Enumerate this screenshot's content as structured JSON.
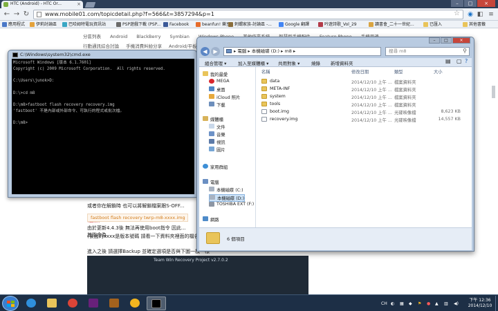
{
  "browser": {
    "tab_title": "HTC (Android) - HTC Or...",
    "url": "www.mobile01.com/topicdetail.php?f=566&t=3857294&p=1",
    "bookmarks": [
      "應用程式",
      "伊莉討論區",
      "巴哈姆特電玩資訊站",
      "PSP遊戲下載 (PSP...",
      "Facebook",
      "beanfun! 樂豆",
      "刺蝟家族-討論區 -...",
      "Google 翻譯",
      "吟遊詩歌_Vol_29",
      "讀書會_二十一世紀...",
      "已匯入",
      "其他書籤"
    ]
  },
  "webpage": {
    "nav1": [
      "分區列表",
      "Android",
      "BlackBerry",
      "Symbian",
      "Windows Phone",
      "其他作業系統",
      "智慧型手機配件",
      "Feature Phone",
      "手機周邊"
    ],
    "nav2": [
      "行動通訊綜合討論",
      "手機消費糾紛分享",
      "Android/平板..."
    ],
    "p_boot": "或者你在解鎖時 也可以將解鎖檔案跟S-OFF...",
    "update_label": "(更新)",
    "p_update1": "由於更新4.4.3後 無法再使用boot指令 因此...",
    "p_update2": "其指令為",
    "code": "fastboot flash recovery twrp-m8-xxxx.img",
    "p_xxxx": "(後面的xxxx是版本號碼 請看一下資料夾裡面的檔名下去打)",
    "p_backup": "進入之後 請選擇Backup 並確定選項是否與下圖一模一樣",
    "twrp_banner": "Team Win Recovery Project  v2.7.0.2"
  },
  "cmd": {
    "title": "C:\\Windows\\system32\\cmd.exe",
    "lines": [
      "Microsoft Windows [版本 6.1.7601]",
      "Copyright (c) 2009 Microsoft Corporation.  All rights reserved.",
      "",
      "C:\\Users\\junok>D:",
      "",
      "D:\\>cd m8",
      "",
      "D:\\m8>fastboot flash recovery recovery.img",
      "'fastboot' 不是內部或外部命令、可執行的程式或批次檔。",
      "",
      "D:\\m8>"
    ]
  },
  "explorer": {
    "breadcrumb": "▸ 電腦 ▸ 本機磁碟 (D:) ▸ m8 ▸",
    "search_placeholder": "搜尋 m8",
    "toolbar": [
      "組合管理 ▾",
      "加入至媒體櫃 ▾",
      "共用對象 ▾",
      "燒錄",
      "新增資料夾"
    ],
    "nav": {
      "favorites": "我的最愛",
      "mega": "MEGA",
      "desktop": "桌面",
      "icloud": "iCloud 照片",
      "downloads": "下載",
      "libraries": "媒體櫃",
      "documents": "文件",
      "music": "音樂",
      "videos": "視訊",
      "pictures": "圖片",
      "homegroup": "家用群組",
      "computer": "電腦",
      "drive_c": "本機磁碟 (C:)",
      "drive_d": "本機磁碟 (D:)",
      "drive_f": "TOSHIBA EXT (F:)",
      "network": "網路"
    },
    "columns": {
      "name": "名稱",
      "date": "修改日期",
      "type": "類型",
      "size": "大小"
    },
    "files": [
      {
        "name": "data",
        "date": "2014/12/10 上午 ...",
        "type": "檔案資料夾",
        "size": "",
        "kind": "folder"
      },
      {
        "name": "META-INF",
        "date": "2014/12/10 上午 ...",
        "type": "檔案資料夾",
        "size": "",
        "kind": "folder"
      },
      {
        "name": "system",
        "date": "2014/12/10 上午 ...",
        "type": "檔案資料夾",
        "size": "",
        "kind": "folder"
      },
      {
        "name": "tools",
        "date": "2014/12/10 上午 ...",
        "type": "檔案資料夾",
        "size": "",
        "kind": "folder"
      },
      {
        "name": "boot.img",
        "date": "2014/12/10 上午 ...",
        "type": "光碟映像檔",
        "size": "8,623 KB",
        "kind": "file"
      },
      {
        "name": "recovery.img",
        "date": "2014/12/10 上午 ...",
        "type": "光碟映像檔",
        "size": "14,557 KB",
        "kind": "file"
      }
    ],
    "status": "6 個項目"
  },
  "taskbar": {
    "lang": "CH",
    "time": "下午 12:36",
    "date": "2014/12/10"
  },
  "colors": {
    "taskbar": "#1d2f46",
    "window_frame": "#b9cbe1",
    "code_text": "#d27c1a",
    "update_red": "#cc2222",
    "folder": "#e9c45a"
  }
}
